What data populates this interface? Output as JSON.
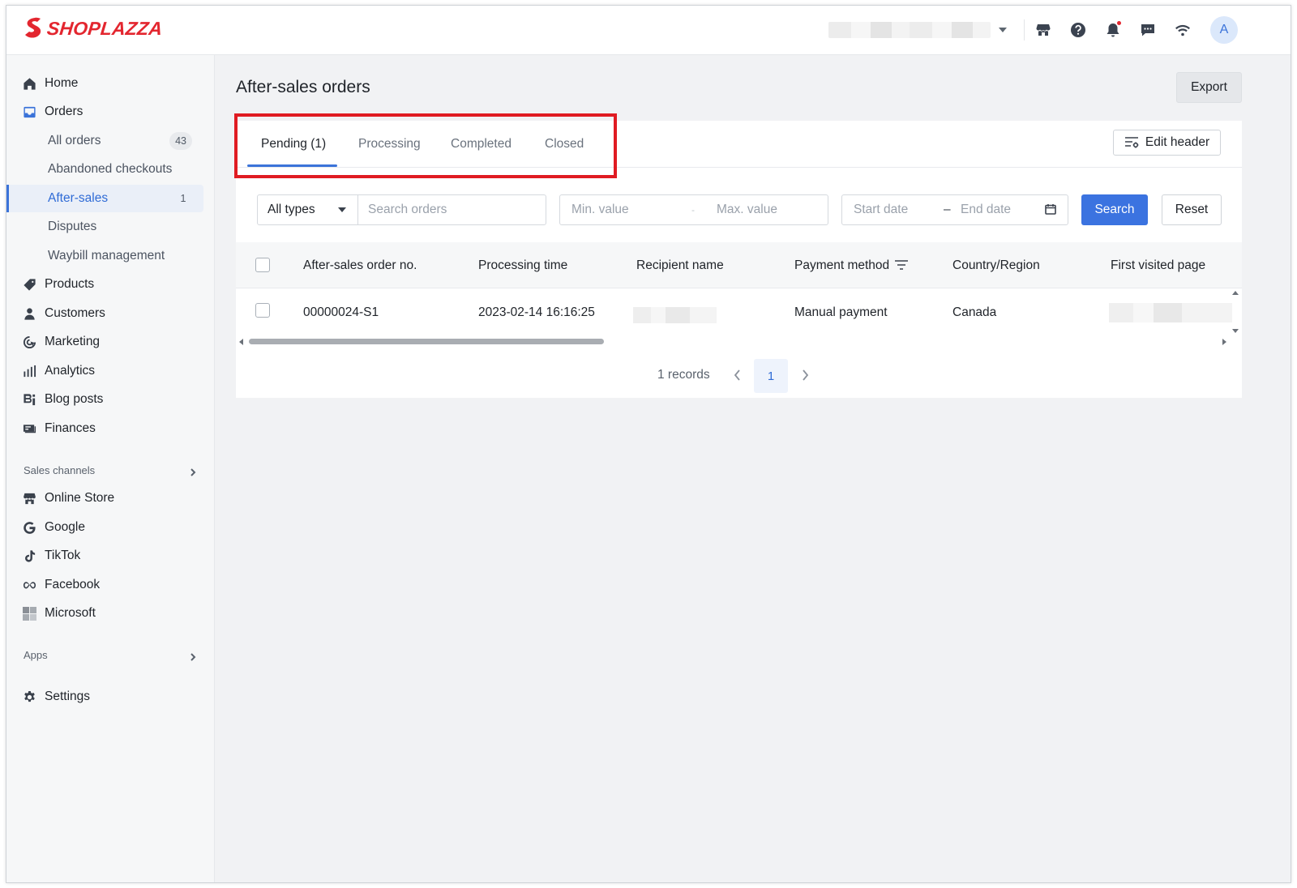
{
  "brand": {
    "name": "SHOPLAZZA",
    "color": "#e3262f"
  },
  "topbar": {
    "avatar_initial": "A",
    "icons": [
      "store-icon",
      "help-icon",
      "bell-icon",
      "chat-icon",
      "wifi-icon"
    ]
  },
  "sidebar": {
    "items": [
      {
        "label": "Home",
        "icon": "home-icon"
      },
      {
        "label": "Orders",
        "icon": "orders-icon"
      },
      {
        "label": "All orders",
        "count": "43"
      },
      {
        "label": "Abandoned checkouts"
      },
      {
        "label": "After-sales",
        "count": "1",
        "active": true
      },
      {
        "label": "Disputes"
      },
      {
        "label": "Waybill management"
      },
      {
        "label": "Products",
        "icon": "tag-icon"
      },
      {
        "label": "Customers",
        "icon": "person-icon"
      },
      {
        "label": "Marketing",
        "icon": "marketing-icon"
      },
      {
        "label": "Analytics",
        "icon": "bar-chart-icon"
      },
      {
        "label": "Blog posts",
        "icon": "blog-icon"
      },
      {
        "label": "Finances",
        "icon": "finances-icon"
      }
    ],
    "sales_channels_label": "Sales channels",
    "channels": [
      {
        "label": "Online Store",
        "icon": "store-icon"
      },
      {
        "label": "Google",
        "icon": "google-icon"
      },
      {
        "label": "TikTok",
        "icon": "tiktok-icon"
      },
      {
        "label": "Facebook",
        "icon": "meta-icon"
      },
      {
        "label": "Microsoft",
        "icon": "microsoft-icon"
      }
    ],
    "apps_label": "Apps",
    "settings_label": "Settings"
  },
  "page": {
    "title": "After-sales orders",
    "export_label": "Export",
    "edit_header_label": "Edit header"
  },
  "tabs": [
    {
      "label": "Pending  (1)",
      "active": true
    },
    {
      "label": "Processing"
    },
    {
      "label": "Completed"
    },
    {
      "label": "Closed"
    }
  ],
  "filters": {
    "type_value": "All types",
    "search_placeholder": "Search orders",
    "min_placeholder": "Min. value",
    "range_separator": "-",
    "max_placeholder": "Max. value",
    "start_date_placeholder": "Start date",
    "date_separator": "–",
    "end_date_placeholder": "End date",
    "search_label": "Search",
    "reset_label": "Reset"
  },
  "table": {
    "columns": [
      "After-sales order no.",
      "Processing time",
      "Recipient name",
      "Payment method",
      "Country/Region",
      "First visited page"
    ],
    "rows": [
      {
        "order_no": "00000024-S1",
        "processing_time": "2023-02-14 16:16:25",
        "payment_method": "Manual payment",
        "country": "Canada"
      }
    ]
  },
  "pagination": {
    "records_text": "1 records",
    "current_page": "1"
  },
  "colors": {
    "accent": "#3b73e0",
    "highlight": "#e01b22"
  }
}
